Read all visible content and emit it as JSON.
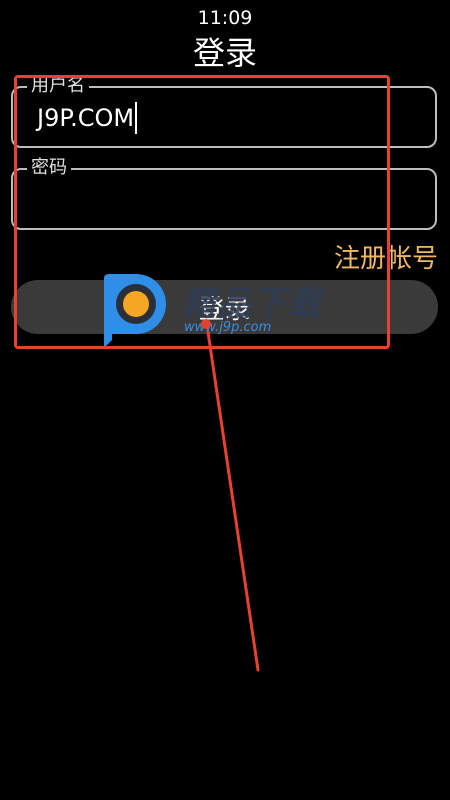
{
  "status_bar": {
    "time": "11:09"
  },
  "header": {
    "title": "登录"
  },
  "form": {
    "username": {
      "label": "用户名",
      "value": "J9P.COM"
    },
    "password": {
      "label": "密码",
      "value": ""
    },
    "register_label": "注册帐号",
    "login_label": "登录"
  },
  "watermark": {
    "text": "精品下载",
    "url": "www.j9p.com"
  },
  "colors": {
    "background": "#000000",
    "field_border": "#bdbdbd",
    "accent": "#f0b865",
    "button_bg": "#3a3a3a",
    "annotation": "#e8412f"
  },
  "icons": {
    "watermark_logo": "p-logo-icon"
  }
}
